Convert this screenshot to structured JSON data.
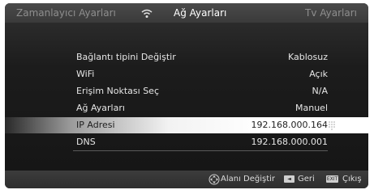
{
  "tabs": {
    "left": "Zamanlayıcı Ayarları",
    "center": "Ağ Ayarları",
    "right": "Tv Ayarları"
  },
  "settings": [
    {
      "label": "Bağlantı tipini Değiştir",
      "value": "Kablosuz"
    },
    {
      "label": "WiFi",
      "value": "Açık"
    },
    {
      "label": "Erişim Noktası Seç",
      "value": "N/A"
    },
    {
      "label": "Ağ Ayarları",
      "value": "Manuel"
    },
    {
      "label": "IP Adresi",
      "value": "192.168.000.164"
    },
    {
      "label": "DNS",
      "value": "192.168.000.001"
    }
  ],
  "footer": {
    "navigate_label": "Alanı Değiştir",
    "back_key": "◄",
    "back_label": "Geri",
    "exit_key": "EXIT",
    "exit_label": "Çıkış"
  },
  "icons": [
    "wifi-icon",
    "dpad-icon",
    "back-key-icon",
    "exit-key-icon",
    "numpad-dots-icon"
  ],
  "colors": {
    "background": "#1a1a1a",
    "tab_active": "#ffffff",
    "tab_inactive": "#8e8e8e",
    "selected_row": "#ffffff"
  }
}
